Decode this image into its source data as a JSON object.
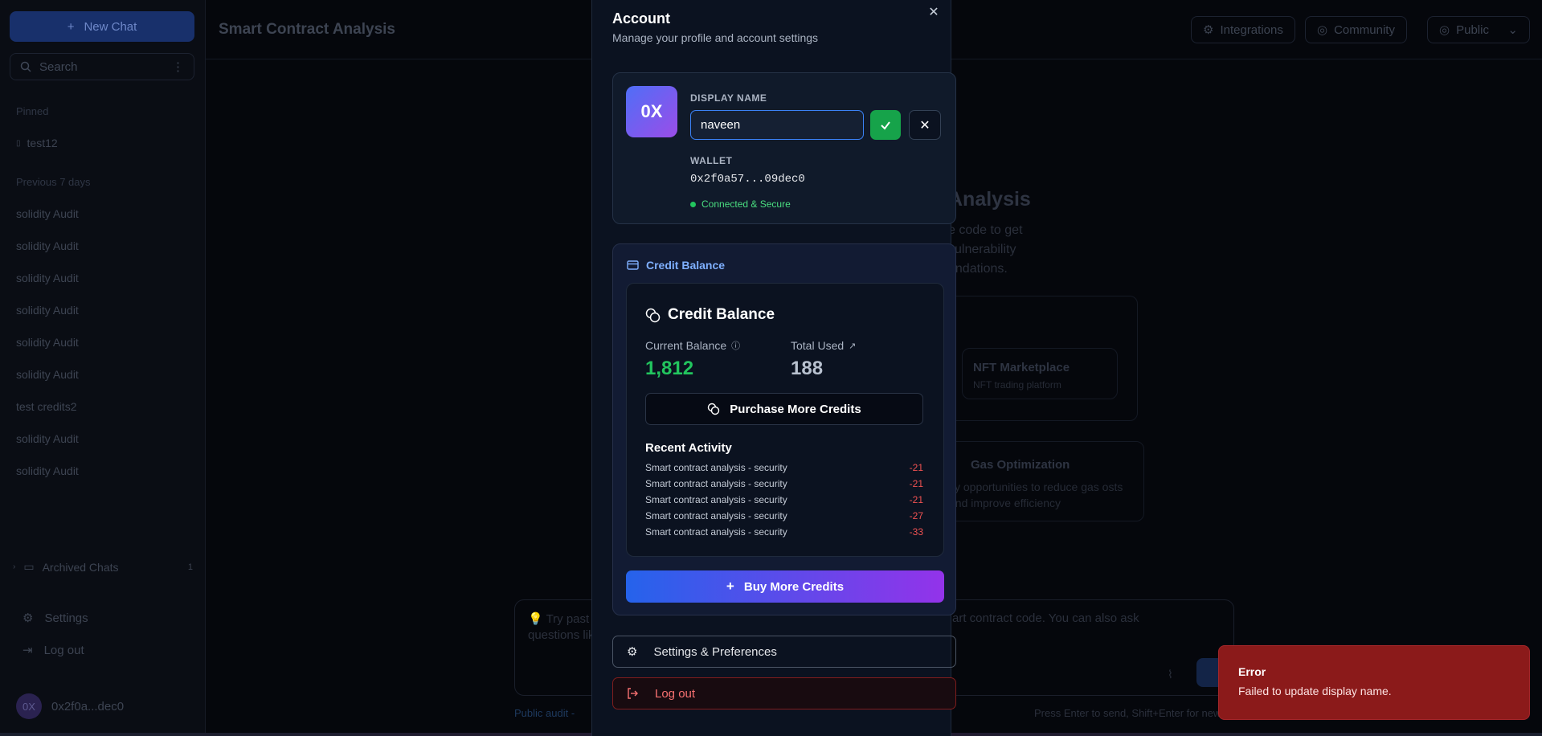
{
  "sidebar": {
    "new_chat_label": "New Chat",
    "search_placeholder": "Search",
    "pinned_heading": "Pinned",
    "pinned_items": [
      "test12"
    ],
    "recent_heading": "Previous 7 days",
    "recent_items": [
      "solidity Audit",
      "solidity Audit",
      "solidity Audit",
      "solidity Audit",
      "solidity Audit",
      "solidity Audit",
      "test credits2",
      "solidity Audit",
      "solidity Audit"
    ],
    "archived_label": "Archived Chats",
    "archived_count": "1",
    "settings_label": "Settings",
    "logout_label": "Log out",
    "user_avatar": "0X",
    "user_wallet_short": "0x2f0a...dec0"
  },
  "header": {
    "title": "Smart Contract Analysis",
    "integrations_label": "Integrations",
    "community_label": "Community",
    "visibility_label": "Public"
  },
  "background": {
    "hero_title": "Analysis",
    "hero_sub": "e code to get vulnerability endations.",
    "card1_title": "NFT Marketplace",
    "card1_sub": "NFT trading platform",
    "card2_title": "Gas Optimization",
    "card2_sub": "ify opportunities to reduce gas osts and improve efficiency",
    "composer_placeholder_left": "💡 Try past questions lik",
    "composer_placeholder_right": "art contract code. You can also ask",
    "footer_left": "Public audit -",
    "footer_right": "Press Enter to send, Shift+Enter for new"
  },
  "modal": {
    "title": "Account",
    "subtitle": "Manage your profile and account settings",
    "avatar": "0X",
    "display_name_label": "DISPLAY NAME",
    "display_name_value": "naveen",
    "wallet_label": "WALLET",
    "wallet_address": "0x2f0a57...09dec0",
    "wallet_status": "Connected & Secure",
    "credit_section_label": "Credit Balance",
    "credit_title": "Credit Balance",
    "current_balance_label": "Current Balance",
    "current_balance_value": "1,812",
    "total_used_label": "Total Used",
    "total_used_value": "188",
    "purchase_label": "Purchase More Credits",
    "recent_activity_title": "Recent Activity",
    "activity": [
      {
        "desc": "Smart contract analysis - security",
        "amount": "-21"
      },
      {
        "desc": "Smart contract analysis - security",
        "amount": "-21"
      },
      {
        "desc": "Smart contract analysis - security",
        "amount": "-21"
      },
      {
        "desc": "Smart contract analysis - security",
        "amount": "-27"
      },
      {
        "desc": "Smart contract analysis - security",
        "amount": "-33"
      }
    ],
    "buy_label": "Buy More Credits",
    "settings_label": "Settings & Preferences",
    "logout_label": "Log out"
  },
  "toast": {
    "title": "Error",
    "message": "Failed to update display name."
  },
  "colors": {
    "success": "#22c55e",
    "danger": "#f05252",
    "accent": "#3b82f6",
    "toast_bg": "#8b1a1a"
  }
}
